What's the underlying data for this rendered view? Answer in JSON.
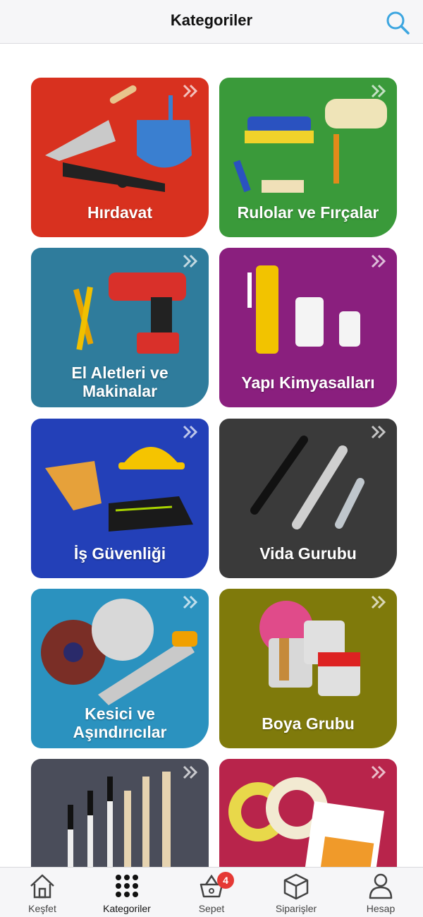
{
  "header": {
    "title": "Kategoriler"
  },
  "categories": [
    {
      "label": "Hırdavat",
      "color": "#d8311f"
    },
    {
      "label": "Rulolar ve Fırçalar",
      "color": "#3a9a3a"
    },
    {
      "label": "El Aletleri ve Makinalar",
      "color": "#2f7c9c"
    },
    {
      "label": "Yapı Kimyasalları",
      "color": "#8a1f7e"
    },
    {
      "label": "İş Güvenliği",
      "color": "#2340b8"
    },
    {
      "label": "Vida Gurubu",
      "color": "#3a3a3a"
    },
    {
      "label": "Kesici ve Aşındırıcılar",
      "color": "#2b92bf"
    },
    {
      "label": "Boya Grubu",
      "color": "#7f7a0b"
    },
    {
      "label": "",
      "color": "#4a4d5a"
    },
    {
      "label": "",
      "color": "#b8244b"
    }
  ],
  "tabs": [
    {
      "label": "Keşfet",
      "icon": "home-icon"
    },
    {
      "label": "Kategoriler",
      "icon": "grid-dots-icon",
      "active": true
    },
    {
      "label": "Sepet",
      "icon": "basket-icon",
      "badge": "4"
    },
    {
      "label": "Siparişler",
      "icon": "box-icon"
    },
    {
      "label": "Hesap",
      "icon": "user-icon"
    }
  ],
  "colors": {
    "accent": "#3da6e0",
    "badge": "#e53935"
  }
}
